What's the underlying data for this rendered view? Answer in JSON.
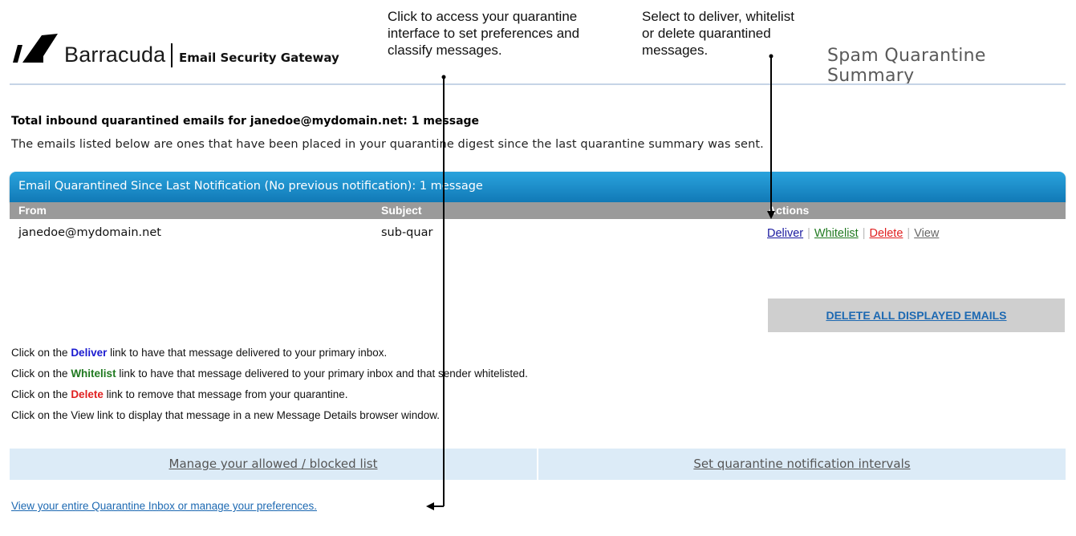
{
  "brand": {
    "name": "Barracuda",
    "product": "Email Security Gateway"
  },
  "callouts": {
    "quarantine_interface": "Click to access your quarantine\ninterface to set preferences and\nclassify messages.",
    "actions": "Select to deliver, whitelist\nor delete quarantined\nmessages."
  },
  "header": {
    "title": "Spam Quarantine Summary"
  },
  "summary": {
    "total_line": "Total inbound quarantined emails for janedoe@mydomain.net: 1 message",
    "intro_line": "The emails listed below are ones that have been placed in your quarantine digest since the last quarantine summary was sent."
  },
  "table": {
    "title": "Email Quarantined Since Last Notification (No previous notification): 1 message",
    "columns": [
      "From",
      "Subject",
      "Actions"
    ],
    "rows": [
      {
        "from": "janedoe@mydomain.net",
        "subject": "sub-quar"
      }
    ],
    "actions": {
      "deliver": "Deliver",
      "whitelist": "Whitelist",
      "delete": "Delete",
      "view": "View",
      "separator": "|"
    },
    "delete_all_label": "DELETE ALL DISPLAYED EMAILS"
  },
  "help": {
    "prefix": "Click on the",
    "deliver_word": "Deliver",
    "deliver_suffix": "link to have that message delivered to your primary inbox.",
    "whitelist_word": "Whitelist",
    "whitelist_suffix": "link to have that message delivered to your primary inbox and that sender whitelisted.",
    "delete_word": "Delete",
    "delete_suffix": "link to remove that message from your quarantine.",
    "view_line": "Click on the View link to display that message in a new Message Details browser window."
  },
  "links": {
    "allowed_blocked": "Manage your allowed / blocked list",
    "notification_intervals": "Set quarantine notification intervals",
    "quarantine_inbox": "View your entire Quarantine Inbox or manage your preferences."
  },
  "colors": {
    "header_gradient_top": "#2aa3dd",
    "header_gradient_bottom": "#1179b6",
    "column_header_bg": "#9a9a9a",
    "deliver": "#1a1aa0",
    "whitelist": "#217a21",
    "delete": "#e02020",
    "link": "#1d69b2",
    "links_bar_bg": "#dcebf7"
  }
}
